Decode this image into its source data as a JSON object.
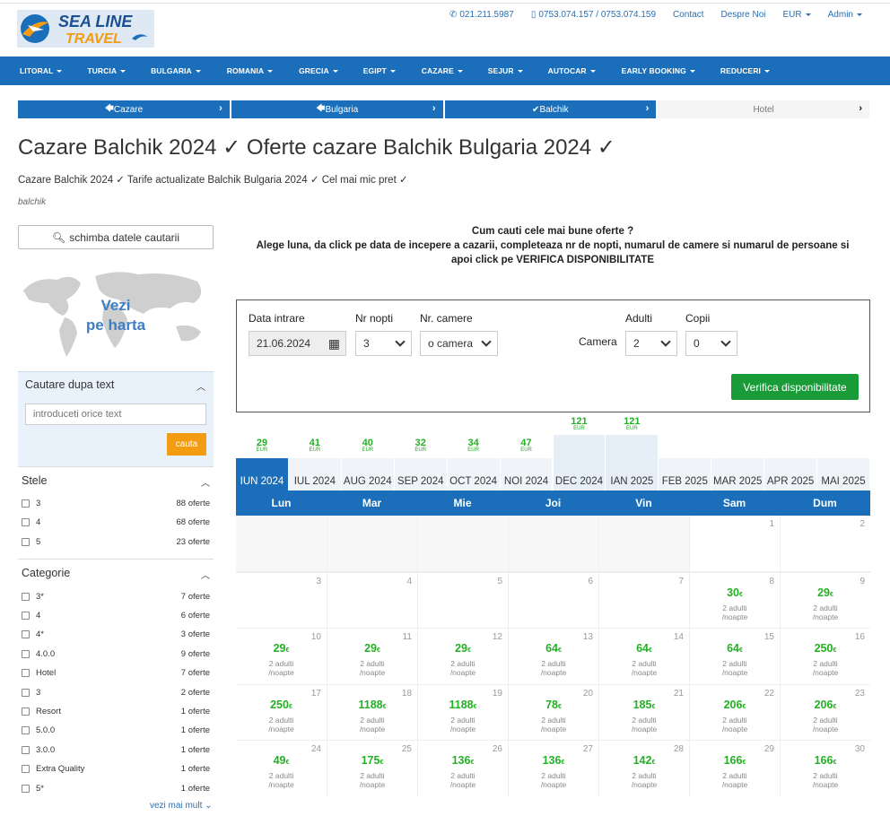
{
  "header": {
    "logo_line1": "SEA LINE",
    "logo_line2": "TRAVEL",
    "phone1": "021.211.5987",
    "phone2": "0753.074.157 / 0753.074.159",
    "contact": "Contact",
    "about": "Despre Noi",
    "currency": "EUR",
    "admin": "Admin"
  },
  "nav": [
    "LITORAL",
    "TURCIA",
    "BULGARIA",
    "ROMANIA",
    "GRECIA",
    "EGIPT",
    "CAZARE",
    "SEJUR",
    "AUTOCAR",
    "EARLY BOOKING",
    "REDUCERI"
  ],
  "breadcrumb": [
    "Cazare",
    "Bulgaria",
    "Balchik",
    "Hotel"
  ],
  "page": {
    "title": "Cazare Balchik 2024 ✓ Oferte cazare Balchik Bulgaria 2024 ✓",
    "subtitle": "Cazare Balchik 2024 ✓ Tarife actualizate Balchik Bulgaria 2024 ✓ Cel mai mic pret ✓",
    "tag": "balchik"
  },
  "sidebar": {
    "change_search": "schimba datele cautarii",
    "map_label_1": "Vezi",
    "map_label_2": "pe harta",
    "text_search_title": "Cautare dupa text",
    "text_search_placeholder": "introduceti orice text",
    "search_btn": "cauta",
    "stars_title": "Stele",
    "stars": [
      {
        "label": "3",
        "count": "88 oferte"
      },
      {
        "label": "4",
        "count": "68 oferte"
      },
      {
        "label": "5",
        "count": "23 oferte"
      }
    ],
    "category_title": "Categorie",
    "categories": [
      {
        "label": "3*",
        "count": "7 oferte"
      },
      {
        "label": "4",
        "count": "6 oferte"
      },
      {
        "label": "4*",
        "count": "3 oferte"
      },
      {
        "label": "4.0.0",
        "count": "9 oferte"
      },
      {
        "label": "Hotel",
        "count": "7 oferte"
      },
      {
        "label": "3",
        "count": "2 oferte"
      },
      {
        "label": "Resort",
        "count": "1 oferte"
      },
      {
        "label": "5.0.0",
        "count": "1 oferte"
      },
      {
        "label": "3.0.0",
        "count": "1 oferte"
      },
      {
        "label": "Extra Quality",
        "count": "1 oferte"
      },
      {
        "label": "5*",
        "count": "1 oferte"
      }
    ],
    "more": "vezi mai mult"
  },
  "instructions": {
    "line1": "Cum cauti cele mai bune oferte ?",
    "line2": "Alege luna, da click pe data de incepere a cazarii, completeaza nr de nopti, numarul de camere si numarul de persoane si",
    "line3": "apoi click pe VERIFICA DISPONIBILITATE"
  },
  "form": {
    "checkin_label": "Data intrare",
    "checkin_value": "21.06.2024",
    "nights_label": "Nr nopti",
    "nights_value": "3",
    "rooms_label": "Nr. camere",
    "rooms_value": "o camera",
    "room_label": "Camera",
    "adults_label": "Adulti",
    "adults_value": "2",
    "children_label": "Copii",
    "children_value": "0",
    "submit": "Verifica disponibilitate"
  },
  "months": [
    {
      "label": "IUN 2024",
      "price": "29",
      "cur": "EUR",
      "active": true
    },
    {
      "label": "IUL 2024",
      "price": "41",
      "cur": "EUR"
    },
    {
      "label": "AUG 2024",
      "price": "40",
      "cur": "EUR"
    },
    {
      "label": "SEP 2024",
      "price": "32",
      "cur": "EUR"
    },
    {
      "label": "OCT 2024",
      "price": "34",
      "cur": "EUR"
    },
    {
      "label": "NOI 2024",
      "price": "47",
      "cur": "EUR"
    },
    {
      "label": "DEC 2024",
      "price": "121",
      "cur": "EUR",
      "highlight": true
    },
    {
      "label": "IAN 2025",
      "price": "121",
      "cur": "EUR",
      "highlight": true
    },
    {
      "label": "FEB 2025"
    },
    {
      "label": "MAR 2025"
    },
    {
      "label": "APR 2025"
    },
    {
      "label": "MAI 2025"
    }
  ],
  "calendar": {
    "weekdays": [
      "Lun",
      "Mar",
      "Mie",
      "Joi",
      "Vin",
      "Sam",
      "Dum"
    ],
    "per_unit": "2 adulti",
    "per_unit2": "/noapte",
    "currency_symbol": "€",
    "cells": [
      {
        "day": "",
        "price": ""
      },
      {
        "day": "",
        "price": ""
      },
      {
        "day": "",
        "price": ""
      },
      {
        "day": "",
        "price": ""
      },
      {
        "day": "",
        "price": ""
      },
      {
        "day": "1",
        "price": ""
      },
      {
        "day": "2",
        "price": ""
      },
      {
        "day": "3",
        "price": ""
      },
      {
        "day": "4",
        "price": ""
      },
      {
        "day": "5",
        "price": ""
      },
      {
        "day": "6",
        "price": ""
      },
      {
        "day": "7",
        "price": ""
      },
      {
        "day": "8",
        "price": "30"
      },
      {
        "day": "9",
        "price": "29"
      },
      {
        "day": "10",
        "price": "29"
      },
      {
        "day": "11",
        "price": "29"
      },
      {
        "day": "12",
        "price": "29"
      },
      {
        "day": "13",
        "price": "64"
      },
      {
        "day": "14",
        "price": "64"
      },
      {
        "day": "15",
        "price": "64"
      },
      {
        "day": "16",
        "price": "250"
      },
      {
        "day": "17",
        "price": "250"
      },
      {
        "day": "18",
        "price": "1188"
      },
      {
        "day": "19",
        "price": "1188"
      },
      {
        "day": "20",
        "price": "78"
      },
      {
        "day": "21",
        "price": "185"
      },
      {
        "day": "22",
        "price": "206"
      },
      {
        "day": "23",
        "price": "206"
      },
      {
        "day": "24",
        "price": "49"
      },
      {
        "day": "25",
        "price": "175"
      },
      {
        "day": "26",
        "price": "136"
      },
      {
        "day": "27",
        "price": "136"
      },
      {
        "day": "28",
        "price": "142"
      },
      {
        "day": "29",
        "price": "166"
      },
      {
        "day": "30",
        "price": "166"
      }
    ]
  }
}
